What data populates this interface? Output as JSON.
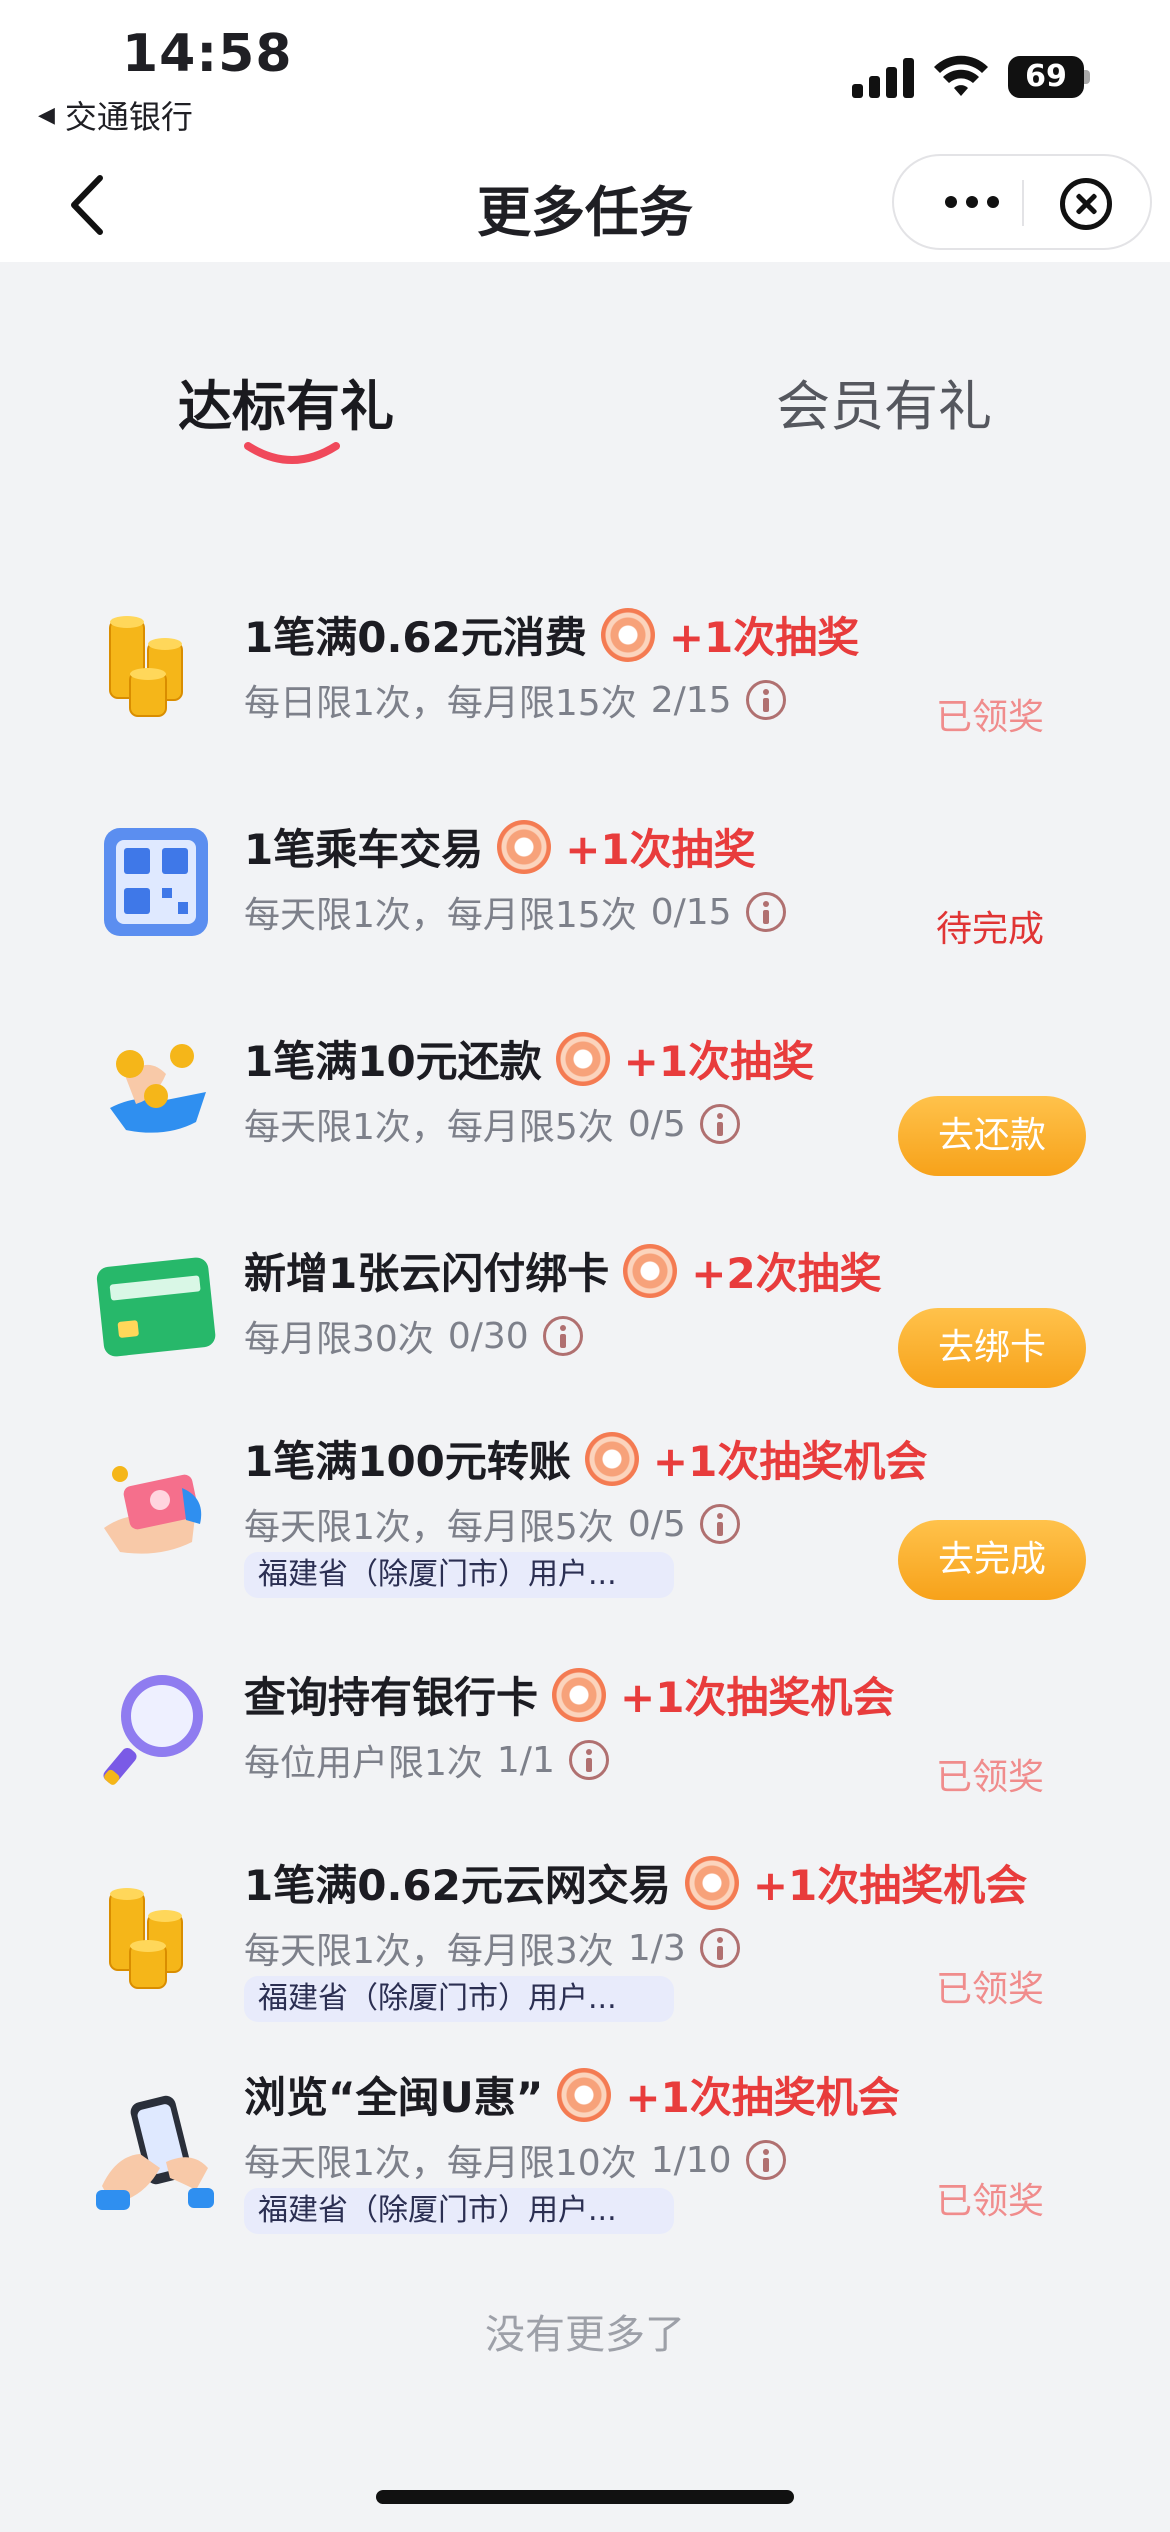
{
  "status_bar": {
    "time": "14:58",
    "back_app": "交通银行",
    "battery": "69",
    "battery_level": 0.69
  },
  "nav": {
    "title": "更多任务"
  },
  "tabs": [
    {
      "label": "达标有礼",
      "active": true
    },
    {
      "label": "会员有礼",
      "active": false
    }
  ],
  "colors": {
    "reward": "#e83c3c",
    "claimed": "#f08c8c",
    "pending": "#e03434",
    "button": "#f7a21a",
    "tab_underline": "#f0495b"
  },
  "tasks": [
    {
      "icon": "gold-coins-icon",
      "title": "1笔满0.62元消费",
      "reward": "+1次抽奖",
      "limit": "每日限1次，每月限15次",
      "progress": "2/15",
      "region": "",
      "status": "已领奖",
      "status_type": "claimed"
    },
    {
      "icon": "qr-code-icon",
      "title": "1笔乘车交易",
      "reward": "+1次抽奖",
      "limit": "每天限1次，每月限15次",
      "progress": "0/15",
      "region": "",
      "status": "待完成",
      "status_type": "pending"
    },
    {
      "icon": "hand-coins-icon",
      "title": "1笔满10元还款",
      "reward": "+1次抽奖",
      "limit": "每天限1次，每月限5次",
      "progress": "0/5",
      "region": "",
      "status": "去还款",
      "status_type": "button"
    },
    {
      "icon": "green-card-icon",
      "title": "新增1张云闪付绑卡",
      "reward": "+2次抽奖",
      "limit": "每月限30次",
      "progress": "0/30",
      "region": "",
      "status": "去绑卡",
      "status_type": "button"
    },
    {
      "icon": "money-transfer-icon",
      "title": "1笔满100元转账",
      "reward": "+1次抽奖机会",
      "limit": "每天限1次，每月限5次",
      "progress": "0/5",
      "region": "福建省（除厦门市）用户...",
      "status": "去完成",
      "status_type": "button"
    },
    {
      "icon": "magnifier-icon",
      "title": "查询持有银行卡",
      "reward": "+1次抽奖机会",
      "limit": "每位用户限1次",
      "progress": "1/1",
      "region": "",
      "status": "已领奖",
      "status_type": "claimed"
    },
    {
      "icon": "gold-coins-icon",
      "title": "1笔满0.62元云网交易",
      "reward": "+1次抽奖机会",
      "limit": "每天限1次，每月限3次",
      "progress": "1/3",
      "region": "福建省（除厦门市）用户...",
      "status": "已领奖",
      "status_type": "claimed"
    },
    {
      "icon": "hand-phone-icon",
      "title": "浏览“全闽U惠”",
      "reward": "+1次抽奖机会",
      "limit": "每天限1次，每月限10次",
      "progress": "1/10",
      "region": "福建省（除厦门市）用户...",
      "status": "已领奖",
      "status_type": "claimed"
    }
  ],
  "footer": {
    "no_more": "没有更多了"
  }
}
